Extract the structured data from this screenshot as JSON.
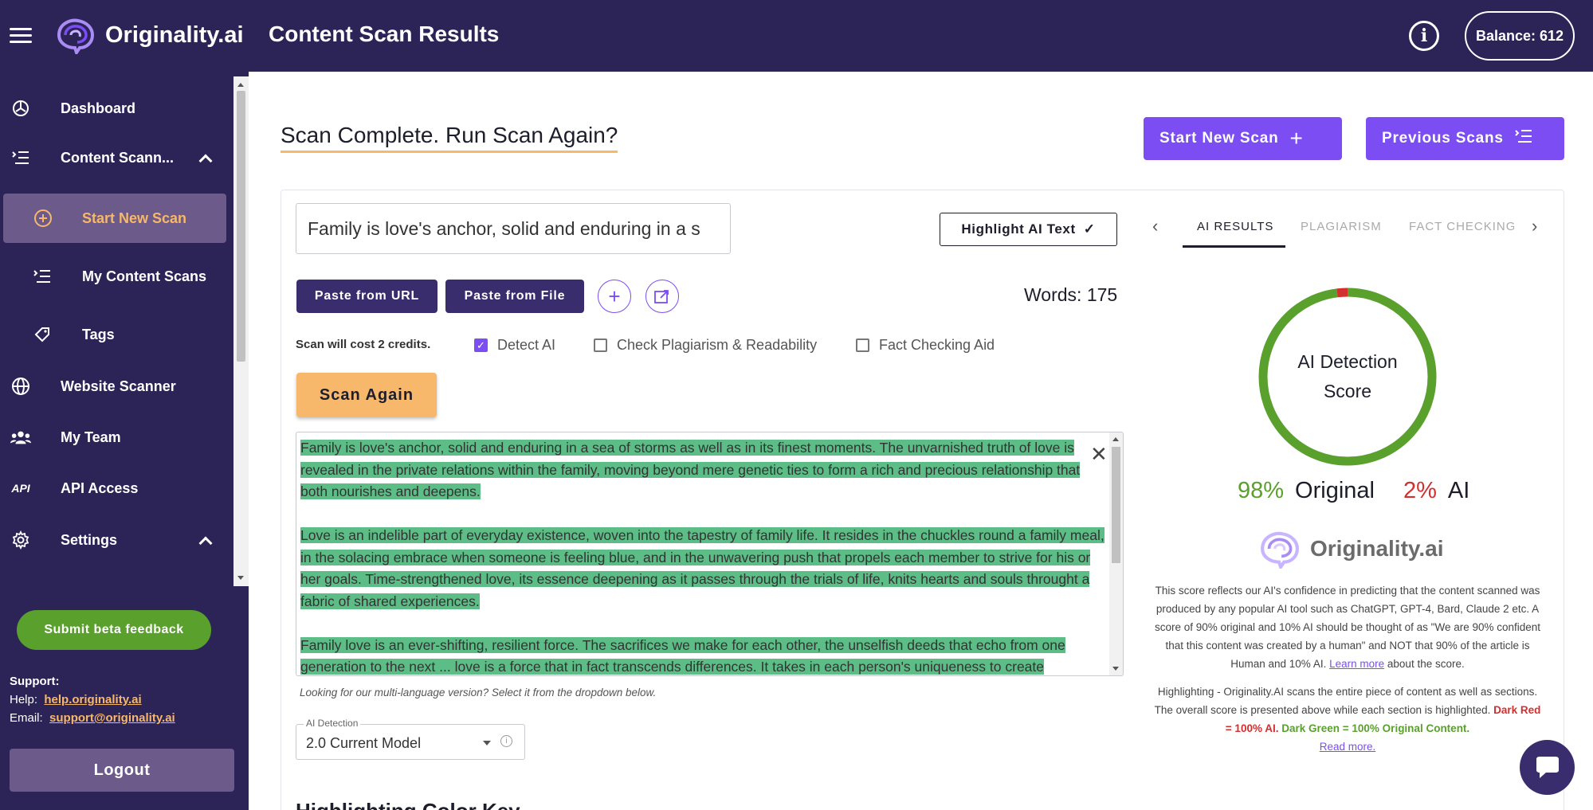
{
  "header": {
    "logo_text": "Originality.ai",
    "page_title": "Content Scan Results",
    "balance": "Balance: 612"
  },
  "sidebar": {
    "items": [
      {
        "label": "Dashboard",
        "icon": "dashboard-icon"
      },
      {
        "label": "Content Scann...",
        "icon": "list-icon"
      },
      {
        "label": "Start New Scan",
        "icon": "plus-circle-icon"
      },
      {
        "label": "My Content Scans",
        "icon": "list-icon"
      },
      {
        "label": "Tags",
        "icon": "tag-icon"
      },
      {
        "label": "Website Scanner",
        "icon": "globe-icon"
      },
      {
        "label": "My Team",
        "icon": "team-icon"
      },
      {
        "label": "API Access",
        "icon": "api-icon"
      },
      {
        "label": "Settings",
        "icon": "gear-icon"
      }
    ],
    "beta_feedback": "Submit beta feedback",
    "support_label": "Support:",
    "help_label": "Help:",
    "help_link": "help.originality.ai",
    "email_label": "Email:",
    "email_link": "support@originality.ai",
    "logout": "Logout"
  },
  "main": {
    "scan_title": "Scan Complete. Run Scan Again?",
    "start_new_scan": "Start New Scan",
    "previous_scans": "Previous Scans",
    "title_input_value": "Family is love's anchor, solid and enduring in a s",
    "highlight_ai_text": "Highlight AI Text",
    "paste_from_url": "Paste from URL",
    "paste_from_file": "Paste from File",
    "words": "Words: 175",
    "cost": "Scan will cost 2 credits.",
    "options": [
      {
        "label": "Detect AI",
        "checked": true
      },
      {
        "label": "Check Plagiarism & Readability",
        "checked": false
      },
      {
        "label": "Fact Checking Aid",
        "checked": false
      }
    ],
    "scan_again": "Scan Again",
    "paragraphs": [
      "Family is love's anchor, solid and enduring in a sea of storms as well as in its finest moments. The unvarnished truth of love is revealed in the private relations within the family, moving beyond mere genetic ties to form a rich and precious relationship that both nourishes and deepens.",
      "Love is an indelible part of everyday existence, woven into the tapestry of family life. It resides in the chuckles round a family meal, in the solacing embrace when someone is feeling blue, and in the unwavering push that propels each member to strive for his or her goals. Time-strengthened love, its essence deepening as it passes through the trials of life, knits hearts and souls throught a fabric of shared experiences.",
      "Family love is an ever-shifting, resilient force. The sacrifices we make for each other, the unselfish deeds that echo from one generation to the next ... love is a force that in fact transcends differences. It takes in each person's uniqueness to create"
    ],
    "multi_lang_note": "Looking for our multi-language version? Select it from the dropdown below.",
    "model_legend": "AI Detection",
    "model_value": "2.0 Current Model",
    "key_heading": "Highlighting Color Key"
  },
  "results": {
    "tabs": [
      "AI RESULTS",
      "PLAGIARISM",
      "FACT CHECKING"
    ],
    "gauge_label_1": "AI Detection",
    "gauge_label_2": "Score",
    "original_pct": 98,
    "ai_pct": 2,
    "original_pct_text": "98%",
    "original_word": "Original",
    "ai_pct_text": "2%",
    "ai_word": "AI",
    "logo_text": "Originality.ai",
    "explain_1": "This score reflects our AI's confidence in predicting that the content scanned was produced by any popular AI tool such as ChatGPT, GPT-4, Bard, Claude 2 etc. A score of 90% original and 10% AI should be thought of as \"We are 90% confident that this content was created by a human\" and NOT that 90% of the article is Human and 10% AI. Learn more about the score.",
    "learn_more": "Learn more",
    "explain_1_tail": "about the score.",
    "explain_2": "Highlighting - Originality.AI scans the entire piece of content as well as sections. The overall score is presented above while each section is highlighted.",
    "dark_red": "Dark Red = 100% AI.",
    "dark_green": "Dark Green = 100% Original Content.",
    "read_more": "Read more."
  },
  "colors": {
    "navy": "#2c2456",
    "purple": "#7b4df3",
    "orange": "#f7b86b",
    "green": "#5aa02c",
    "red": "#d32f2f",
    "highlight_green": "#5dbd86"
  }
}
